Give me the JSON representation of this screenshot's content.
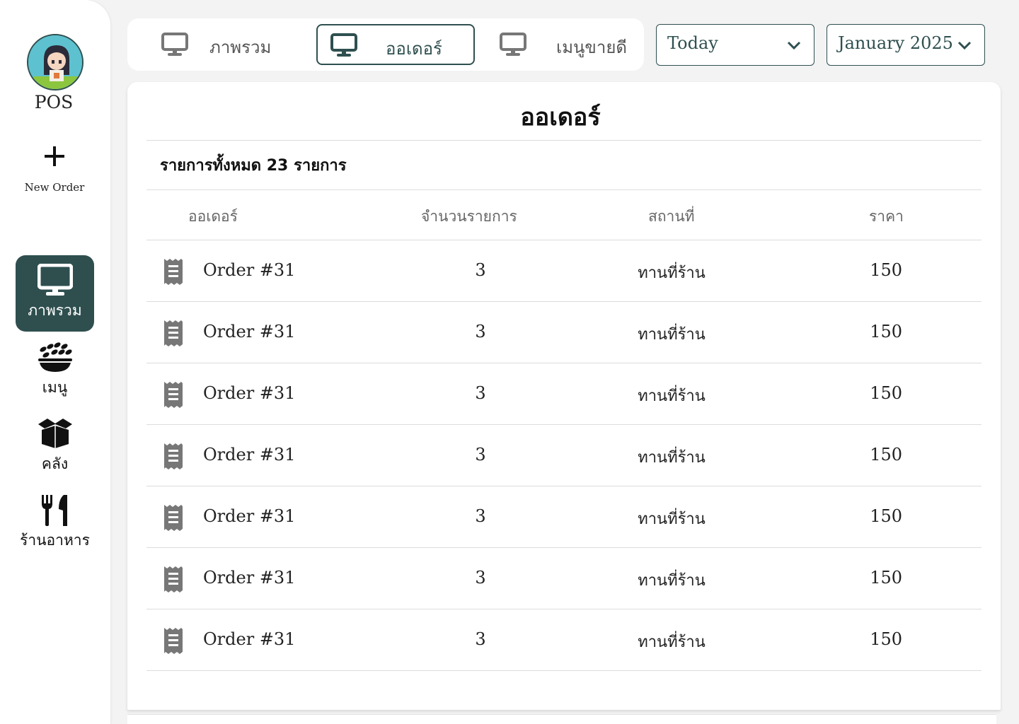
{
  "sidebar": {
    "brand": "POS",
    "new_order_label": "New Order",
    "items": [
      {
        "label": "ภาพรวม",
        "icon": "monitor-icon",
        "active": true
      },
      {
        "label": "เมนู",
        "icon": "food-bowl-icon",
        "active": false
      },
      {
        "label": "คลัง",
        "icon": "box-icon",
        "active": false
      },
      {
        "label": "ร้านอาหาร",
        "icon": "utensils-icon",
        "active": false
      }
    ]
  },
  "tabs": [
    {
      "label": "ภาพรวม",
      "icon": "monitor-icon",
      "active": false
    },
    {
      "label": "ออเดอร์",
      "icon": "monitor-icon",
      "active": true
    },
    {
      "label": "เมนูขายดี",
      "icon": "monitor-icon",
      "active": false
    }
  ],
  "filters": {
    "range": "Today",
    "month": "January 2025"
  },
  "card": {
    "title": "ออเดอร์",
    "summary": "รายการทั้งหมด 23 รายการ",
    "columns": [
      "ออเดอร์",
      "จำนวนรายการ",
      "สถานที่",
      "ราคา"
    ],
    "rows": [
      {
        "order": "Order #31",
        "qty": "3",
        "place": "ทานที่ร้าน",
        "price": "150"
      },
      {
        "order": "Order #31",
        "qty": "3",
        "place": "ทานที่ร้าน",
        "price": "150"
      },
      {
        "order": "Order #31",
        "qty": "3",
        "place": "ทานที่ร้าน",
        "price": "150"
      },
      {
        "order": "Order #31",
        "qty": "3",
        "place": "ทานที่ร้าน",
        "price": "150"
      },
      {
        "order": "Order #31",
        "qty": "3",
        "place": "ทานที่ร้าน",
        "price": "150"
      },
      {
        "order": "Order #31",
        "qty": "3",
        "place": "ทานที่ร้าน",
        "price": "150"
      },
      {
        "order": "Order #31",
        "qty": "3",
        "place": "ทานที่ร้าน",
        "price": "150"
      }
    ]
  },
  "colors": {
    "accent": "#2f4f4f",
    "background": "#f3f3f3",
    "icon_gray": "#777777"
  }
}
